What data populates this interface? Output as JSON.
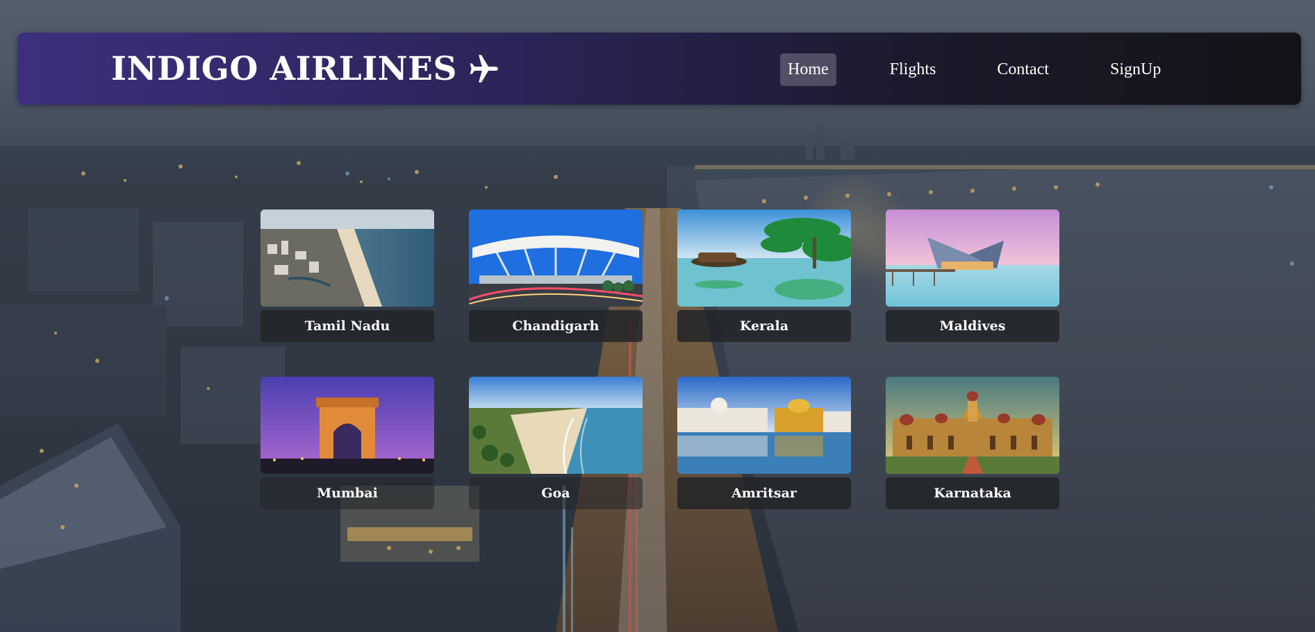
{
  "brand": {
    "title": "INDIGO AIRLINES",
    "icon": "airplane-icon"
  },
  "nav": {
    "items": [
      {
        "label": "Home",
        "active": true
      },
      {
        "label": "Flights",
        "active": false
      },
      {
        "label": "Contact",
        "active": false
      },
      {
        "label": "SignUp",
        "active": false
      }
    ]
  },
  "destinations": [
    {
      "label": "Tamil Nadu",
      "image": "coastline-photo"
    },
    {
      "label": "Chandigarh",
      "image": "airport-photo"
    },
    {
      "label": "Kerala",
      "image": "palm-lagoon-photo"
    },
    {
      "label": "Maldives",
      "image": "water-villa-photo"
    },
    {
      "label": "Mumbai",
      "image": "gateway-arch-photo"
    },
    {
      "label": "Goa",
      "image": "beach-photo"
    },
    {
      "label": "Amritsar",
      "image": "golden-temple-photo"
    },
    {
      "label": "Karnataka",
      "image": "palace-photo"
    }
  ],
  "colors": {
    "navbar_start": "#3c2f7e",
    "navbar_end": "#131317",
    "caption_bg": "#222428",
    "text": "#ffffff"
  }
}
